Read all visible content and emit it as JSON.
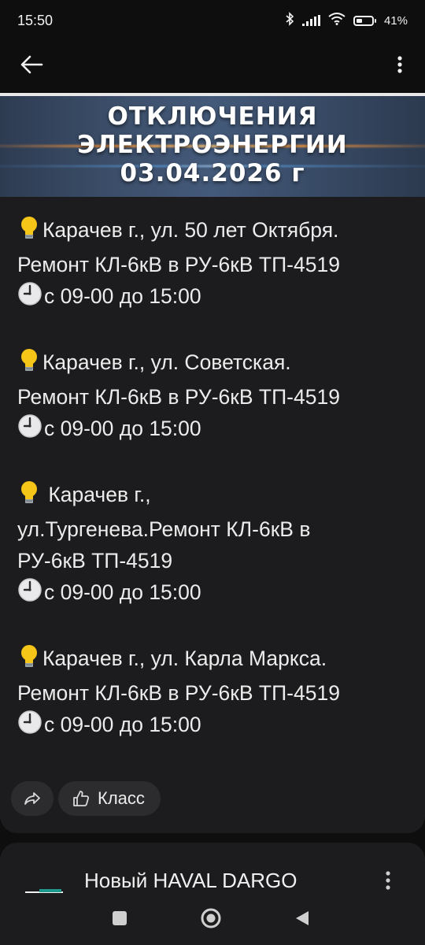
{
  "status_bar": {
    "time": "15:50",
    "battery_percent_label": "41%",
    "battery_level": 0.41,
    "icons": [
      "bluetooth-icon",
      "signal-icon",
      "wifi-icon",
      "battery-icon"
    ]
  },
  "app_bar": {
    "back_icon": "arrow-left-icon",
    "menu_icon": "more-vertical-icon"
  },
  "banner": {
    "title_line1": "ОТКЛЮЧЕНИЯ",
    "title_line2": "ЭЛЕКТРОЭНЕРГИИ",
    "title_line3": "03.04.2026 г"
  },
  "posts": [
    {
      "lines": [
        "Карачев г., ул. 50 лет Октября.",
        "Ремонт КЛ-6кВ в РУ-6кВ ТП-4519",
        "с 09-00 до 15:00"
      ]
    },
    {
      "lines": [
        "Карачев г., ул. Советская.",
        "Ремонт КЛ-6кВ в РУ-6кВ ТП-4519",
        "с 09-00 до 15:00"
      ]
    },
    {
      "lines": [
        " Карачев г.,",
        "ул.Тургенева.Ремонт КЛ-6кВ в",
        "РУ-6кВ ТП-4519",
        "с 09-00 до 15:00"
      ]
    },
    {
      "lines": [
        "Карачев г., ул. Карла Маркса.",
        "Ремонт КЛ-6кВ в РУ-6кВ ТП-4519",
        "с 09-00 до 15:00"
      ]
    }
  ],
  "actions": {
    "like_label": "Класс",
    "share_icon": "share-icon",
    "like_icon": "thumbs-up-icon"
  },
  "ad": {
    "title": "Новый HAVAL DARGO"
  },
  "nav_bar": {
    "icons": [
      "recents-square-icon",
      "home-circle-icon",
      "back-triangle-icon"
    ]
  },
  "colors": {
    "background": "#0e0e0e",
    "card": "#1c1c1e",
    "chip": "#2c2c2e",
    "text": "#ececec"
  }
}
